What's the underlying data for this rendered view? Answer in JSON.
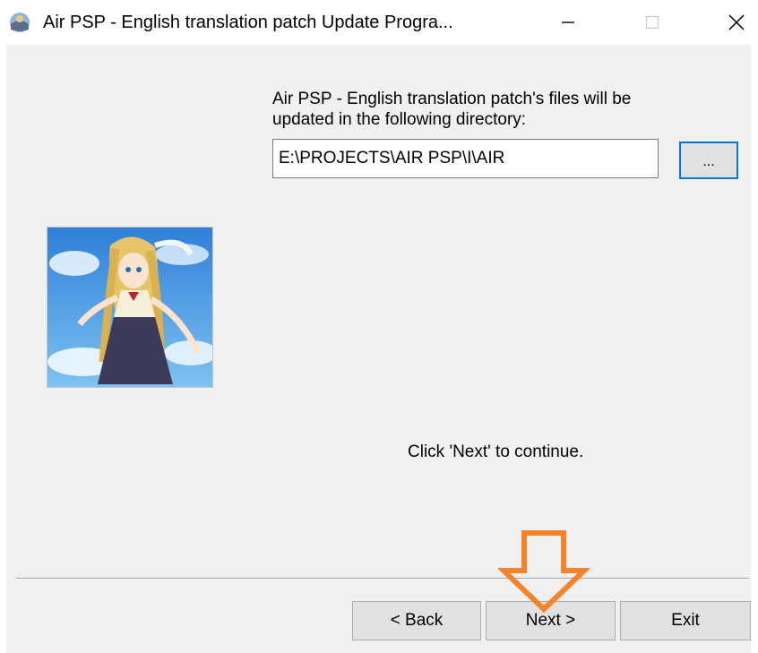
{
  "window": {
    "title": "Air PSP - English translation patch Update Progra...",
    "icon": "app-icon",
    "controls": {
      "minimize": "minimize-icon",
      "maximize": "maximize-icon",
      "close": "close-icon"
    }
  },
  "directory": {
    "label": "Air PSP - English translation patch's files will be updated in the following directory:",
    "path": "E:\\PROJECTS\\AIR PSP\\I\\AIR",
    "browse_label": "..."
  },
  "message": "Click 'Next' to continue.",
  "buttons": {
    "back": "< Back",
    "next": "Next >",
    "exit": "Exit"
  },
  "colors": {
    "client_background": "#f0f0f0",
    "focus_border": "#0078d7",
    "annotation_arrow": "#f5832a"
  }
}
